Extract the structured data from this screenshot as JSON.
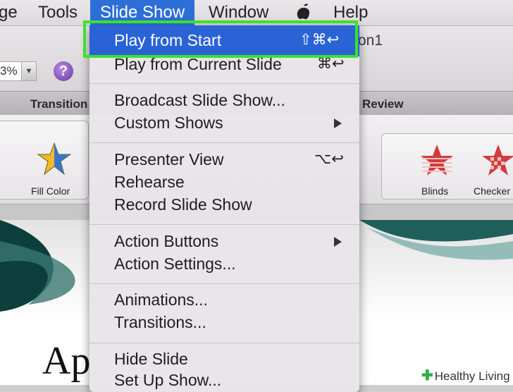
{
  "menubar": {
    "items": [
      "ge",
      "Tools",
      "Slide Show",
      "Window",
      "Help"
    ],
    "active_index": 2,
    "accent_color": "#2d6fd6"
  },
  "document": {
    "title_fragment": "on1"
  },
  "toolbar": {
    "zoom_value": "3%",
    "zoom_arrow": "▼",
    "help_label": "?"
  },
  "tabs": {
    "transitions": "Transition",
    "review": "Review"
  },
  "ribbon": {
    "fill_color_label": "Fill Color",
    "blinds_label": "Blinds",
    "checker_label": "Checker"
  },
  "menu": {
    "highlight_color": "#2a63d6",
    "items": [
      {
        "label": "Play from Start",
        "shortcut": "⇧⌘↩"
      },
      {
        "label": "Play from Current Slide",
        "shortcut": "⌘↩"
      },
      {
        "label": "Broadcast Slide Show...",
        "shortcut": ""
      },
      {
        "label": "Custom Shows",
        "shortcut": ""
      },
      {
        "label": "Presenter View",
        "shortcut": "⌥↩"
      },
      {
        "label": "Rehearse",
        "shortcut": ""
      },
      {
        "label": "Record Slide Show",
        "shortcut": ""
      },
      {
        "label": "Action Buttons",
        "shortcut": ""
      },
      {
        "label": "Action Settings...",
        "shortcut": ""
      },
      {
        "label": "Animations...",
        "shortcut": ""
      },
      {
        "label": "Transitions...",
        "shortcut": ""
      },
      {
        "label": "Hide Slide",
        "shortcut": ""
      },
      {
        "label": "Set Up Show...",
        "shortcut": ""
      }
    ]
  },
  "slide": {
    "title_fragment": "Ap"
  },
  "annotation": {
    "color": "#39e22c"
  },
  "watermark": {
    "label": "Healthy Living"
  }
}
